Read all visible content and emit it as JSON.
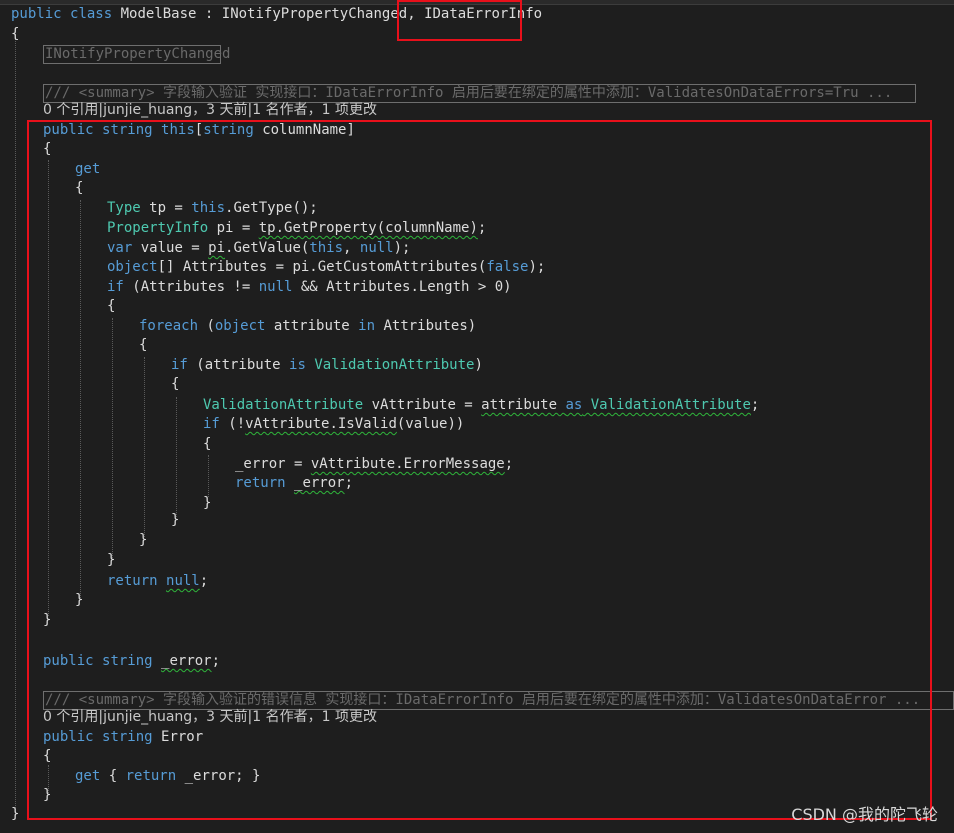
{
  "code": {
    "class_decl": {
      "kw_public": "public",
      "kw_class": "class",
      "class_name": "ModelBase",
      "sep1": " : ",
      "iface1": "INotifyPropertyChanged",
      "sep2": ", ",
      "iface2": "IDataErrorInfo"
    },
    "open_brace": "{",
    "close_brace": "}",
    "collapsed_region": "INotifyPropertyChanged",
    "summary1": "/// <summary> 字段输入验证 实现接口：IDataErrorInfo 启用后要在绑定的属性中添加：ValidatesOnDataErrors=Tru ...",
    "codelens1": "0 个引用|junjie_huang，3 天前|1 名作者，1 项更改",
    "indexer": {
      "kw_public": "public",
      "kw_string": "string",
      "kw_this": "this",
      "lb": "[",
      "kw_string2": "string",
      "param": " columnName",
      "rb": "]"
    },
    "get_kw": "get",
    "l_type": {
      "t": "Type",
      "rest1": " tp = ",
      "kw": "this",
      "rest2": ".GetType();"
    },
    "l_pi": {
      "t": "PropertyInfo",
      "rest1": " pi = ",
      "sq": "tp.GetProperty(columnName)",
      "rest2": ";"
    },
    "l_var": {
      "kw": "var",
      "rest1": " value = ",
      "sq": "pi",
      "rest2": ".GetValue(",
      "kw2": "this",
      "rest3": ", ",
      "kw3": "null",
      "rest4": ");"
    },
    "l_obj": {
      "kw": "object",
      "rest1": "[] Attributes = pi.GetCustomAttributes(",
      "kw2": "false",
      "rest2": ");"
    },
    "l_if1": {
      "kw": "if",
      "rest1": " (Attributes != ",
      "kw2": "null",
      "rest2": " && Attributes.Length > 0)"
    },
    "l_foreach": {
      "kw": "foreach",
      "rest1": " (",
      "kw2": "object",
      "rest2": " attribute ",
      "kw3": "in",
      "rest3": " Attributes)"
    },
    "l_if2": {
      "kw": "if",
      "rest1": " (attribute ",
      "kw2": "is",
      "rest2": " ",
      "t": "ValidationAttribute",
      "rest3": ")"
    },
    "l_va": {
      "t": "ValidationAttribute",
      "rest1": " vAttribute = ",
      "sq1": "attribute ",
      "kw": "as",
      "sq2": " ValidationAttribute",
      "rest2": ";"
    },
    "l_if3": {
      "kw": "if",
      "rest1": " (!",
      "sq": "vAttribute.IsValid",
      "rest2": "(value))"
    },
    "l_err": {
      "sq1": "_error",
      "rest1": " = ",
      "sq2": "vAttribute.ErrorMessage",
      "rest2": ";"
    },
    "l_ret1": {
      "kw": "return",
      "rest1": " ",
      "sq": "_error",
      "rest2": ";"
    },
    "l_ret2": {
      "kw": "return",
      "rest1": " ",
      "sq": "null",
      "rest2": ";"
    },
    "field": {
      "kw1": "public",
      "kw2": "string",
      "rest1": " ",
      "sq": "_error",
      "rest2": ";"
    },
    "summary2": "/// <summary> 字段输入验证的错误信息 实现接口：IDataErrorInfo 启用后要在绑定的属性中添加：ValidatesOnDataError ...",
    "codelens2": "0 个引用|junjie_huang，3 天前|1 名作者，1 项更改",
    "prop": {
      "kw1": "public",
      "kw2": "string",
      "rest1": " Error"
    },
    "getter": {
      "kw1": "get",
      "rest1": " { ",
      "kw2": "return",
      "rest2": " _error; }"
    }
  },
  "watermark": "CSDN @我的陀飞轮",
  "colors": {
    "keyword": "#569cd6",
    "type": "#4ec9b0",
    "comment": "#6a6a6a",
    "highlight_box": "#e8101b",
    "background": "#1e1e1e"
  }
}
